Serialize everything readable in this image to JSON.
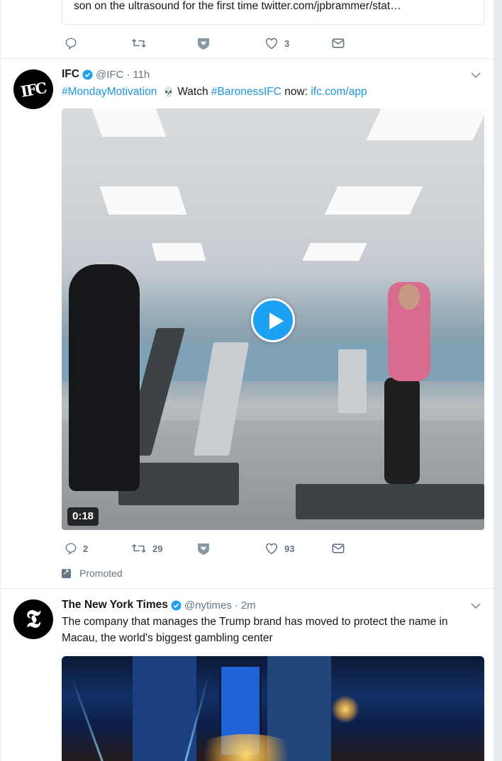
{
  "top_tweet": {
    "quote_text": "son on the ultrasound for the first time twitter.com/jpbrammer/stat…",
    "actions": {
      "reply_count": "",
      "retweet_count": "",
      "like_count": "3"
    }
  },
  "ifc_tweet": {
    "avatar_text": "IFC",
    "name": "IFC",
    "handle": "@IFC",
    "separator": "·",
    "time": "11h",
    "hashtag1": "#MondayMotivation",
    "emoji": "💀",
    "text_watch": " Watch ",
    "hashtag2": "#BaronessIFC",
    "text_now": " now: ",
    "link": "ifc.com/app",
    "video_duration": "0:18",
    "actions": {
      "reply_count": "2",
      "retweet_count": "29",
      "like_count": "93"
    },
    "promoted_label": "Promoted"
  },
  "nyt_tweet": {
    "avatar_text": "𝕿",
    "name": "The New York Times",
    "handle": "@nytimes",
    "separator": "·",
    "time": "2m",
    "text": "The company that manages the Trump brand has moved to protect the name in Macau, the world's biggest gambling center"
  },
  "colors": {
    "link": "#1b95e0",
    "verified": "#1da1f2",
    "muted": "#657786",
    "divider": "#e6ecf0"
  },
  "icons": {
    "reply": "reply-icon",
    "retweet": "retweet-icon",
    "moments": "heart-shield-icon",
    "like": "like-icon",
    "dm": "envelope-icon",
    "more": "chevron-down-icon",
    "verified": "verified-badge-icon",
    "play": "play-icon",
    "promoted": "promoted-arrow-icon"
  }
}
